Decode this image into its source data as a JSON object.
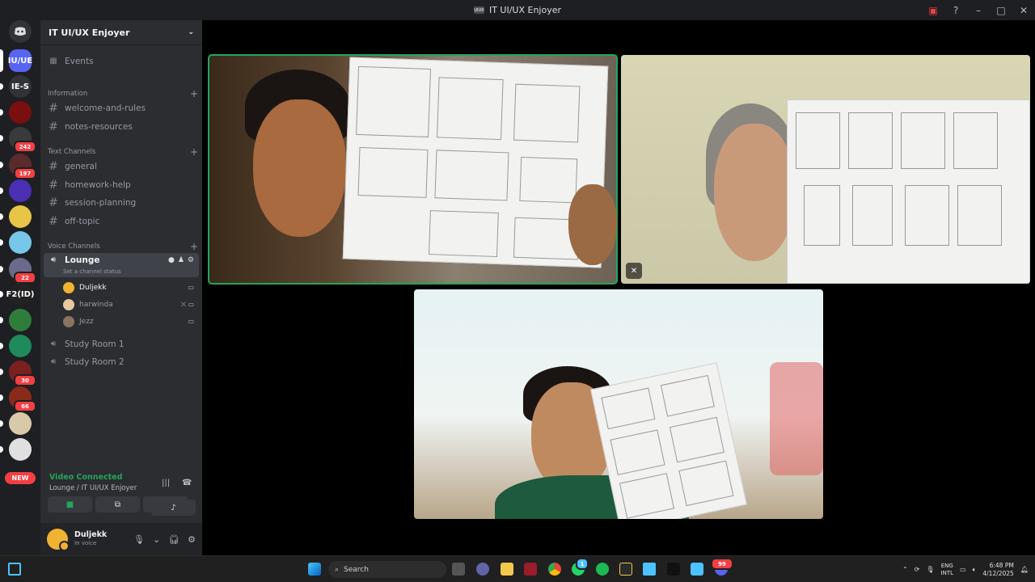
{
  "window": {
    "title": "IT UI/UX Enjoyer",
    "server_icon_text": "UIUX"
  },
  "rail": {
    "servers": [
      {
        "label": "IU/UE",
        "color": "#5865f2"
      },
      {
        "label": "IE-S",
        "color": "#313338"
      },
      {
        "label": "",
        "color": "#7a0f0f"
      },
      {
        "label": "",
        "color": "#3a3a3a",
        "badge": "242"
      },
      {
        "label": "",
        "color": "#5a2b2b",
        "badge": "197"
      },
      {
        "label": "",
        "color": "#4b2fb5"
      },
      {
        "label": "",
        "color": "#e8c447"
      },
      {
        "label": "",
        "color": "#76c7e8"
      },
      {
        "label": "",
        "color": "#6a6a8a",
        "badge": "22"
      },
      {
        "label": "F2(ID)",
        "color": "#222"
      },
      {
        "label": "",
        "color": "#2f7d3b"
      },
      {
        "label": "",
        "color": "#1f8a5c"
      },
      {
        "label": "",
        "color": "#7a2020",
        "badge": "30"
      },
      {
        "label": "",
        "color": "#8a2a1a",
        "badge": "66"
      },
      {
        "label": "",
        "color": "#d8c9a8"
      },
      {
        "label": "",
        "color": "#e0e0e0"
      }
    ],
    "new_badge": "NEW"
  },
  "sidebar": {
    "server_name": "IT UI/UX Enjoyer",
    "events_label": "Events",
    "categories": {
      "information": "Information",
      "text": "Text Channels",
      "voice": "Voice Channels"
    },
    "info_channels": [
      "welcome-and-rules",
      "notes-resources"
    ],
    "text_channels": [
      "general",
      "homework-help",
      "session-planning",
      "off-topic"
    ],
    "voice_channels": {
      "active": {
        "name": "Lounge",
        "status": "Set a channel status"
      },
      "users": [
        {
          "name": "Duljekk",
          "color": "#f0b232",
          "icons": "▭"
        },
        {
          "name": "harwinda",
          "color": "#e8c9a0",
          "icons": "⛌ ▭"
        },
        {
          "name": "Jezz",
          "color": "#8a7360",
          "icons": "▭"
        }
      ],
      "others": [
        "Study Room 1",
        "Study Room 2"
      ]
    }
  },
  "voice_panel": {
    "title": "Video Connected",
    "subtitle": "Lounge / IT UI/UX Enjoyer"
  },
  "user": {
    "name": "Duljekk",
    "status": "In voice"
  },
  "taskbar": {
    "search_placeholder": "Search",
    "lang_top": "ENG",
    "lang_bottom": "INTL",
    "time": "6:48 PM",
    "date": "4/12/2025",
    "chat_badge": "1",
    "discord_badge": "99"
  }
}
